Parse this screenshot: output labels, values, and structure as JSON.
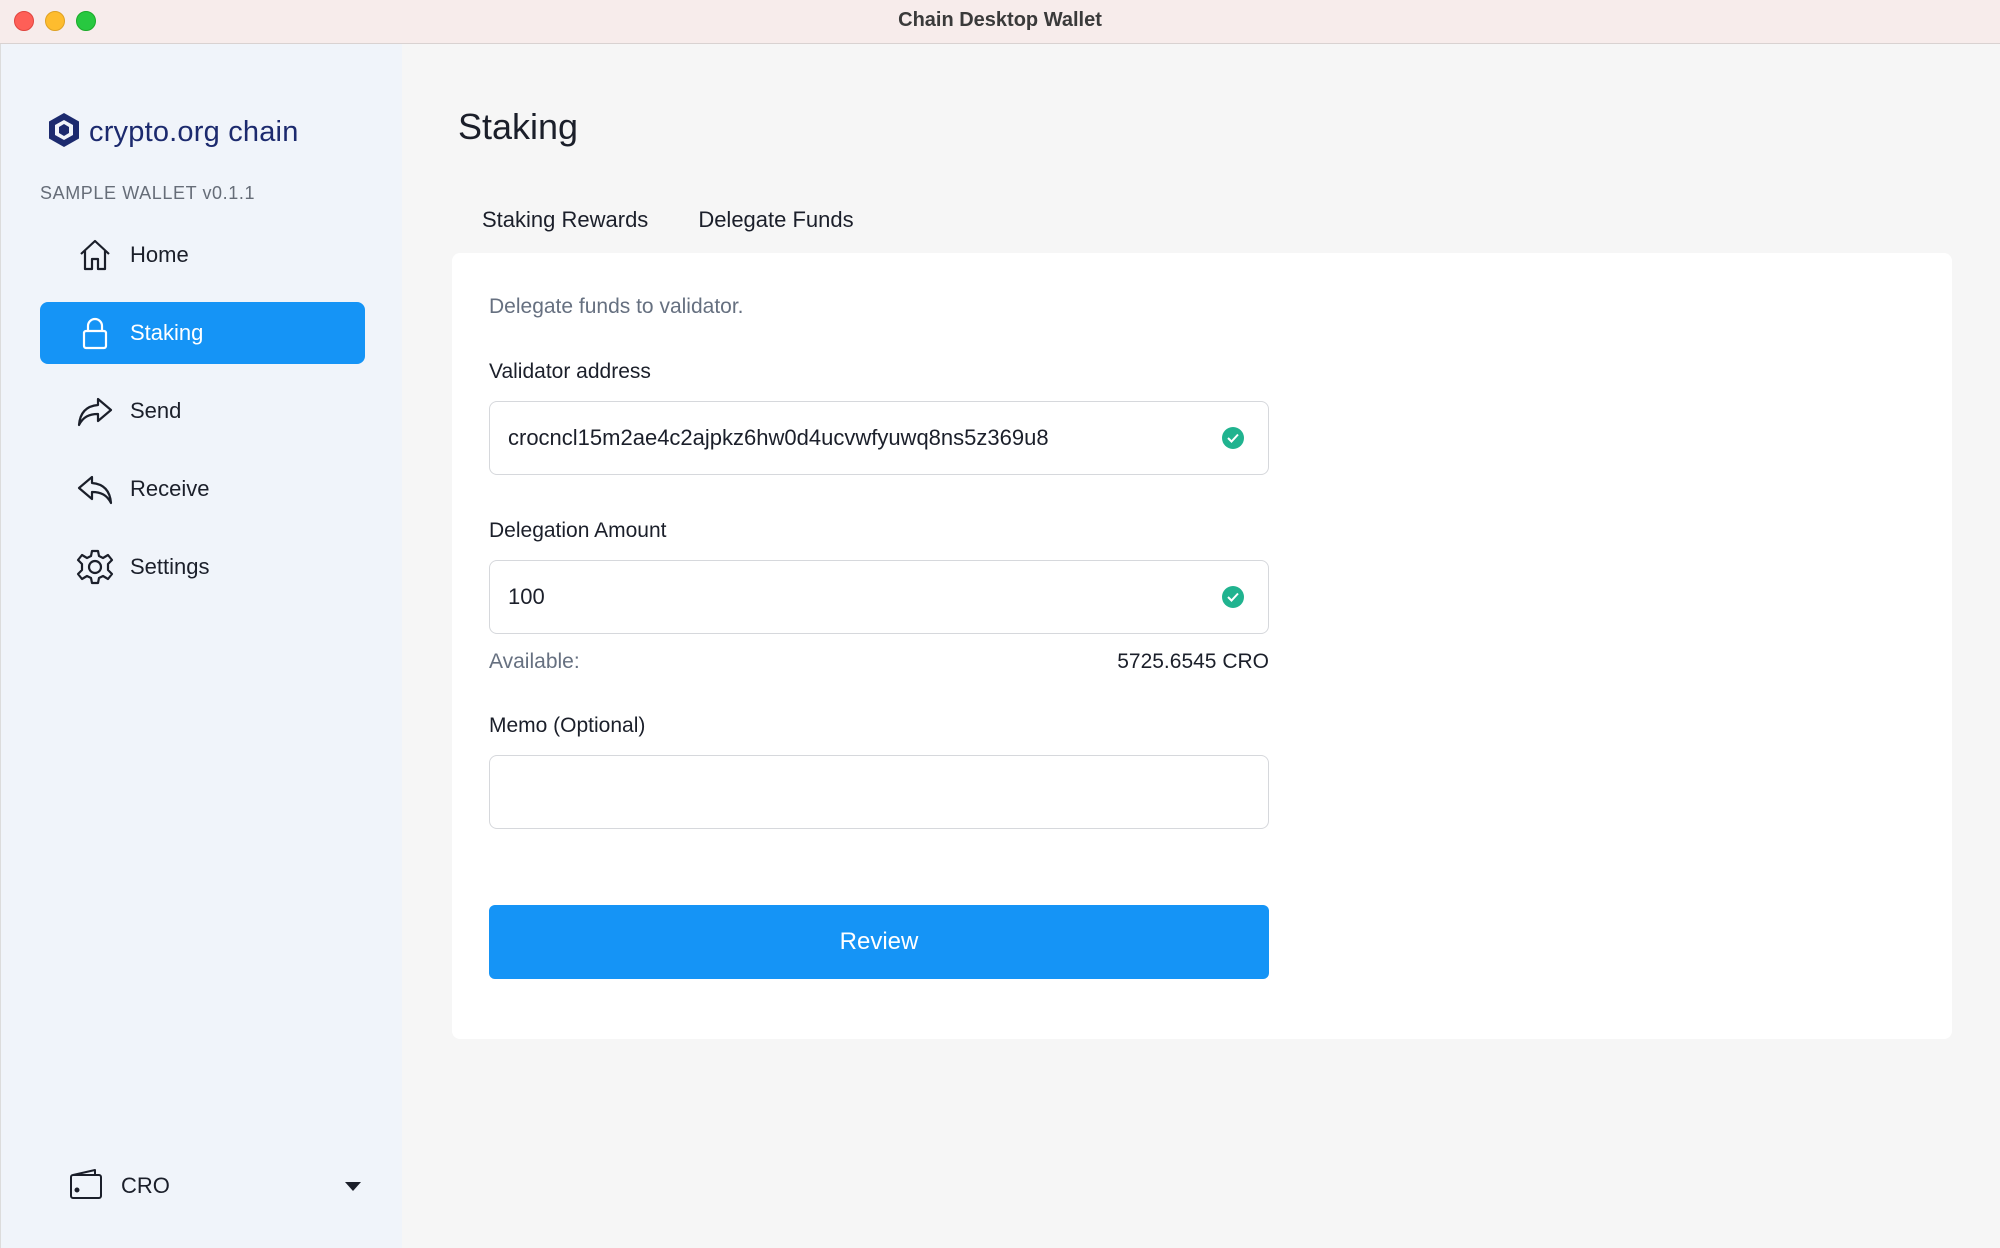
{
  "window": {
    "title": "Chain Desktop Wallet"
  },
  "sidebar": {
    "logo_text": "crypto.org chain",
    "wallet_version": "SAMPLE WALLET v0.1.1",
    "items": [
      {
        "label": "Home",
        "icon": "home-icon"
      },
      {
        "label": "Staking",
        "icon": "lock-icon",
        "active": true
      },
      {
        "label": "Send",
        "icon": "send-arrow-icon"
      },
      {
        "label": "Receive",
        "icon": "receive-arrow-icon"
      },
      {
        "label": "Settings",
        "icon": "gear-icon"
      }
    ],
    "wallet_selector": {
      "label": "CRO",
      "icon": "wallet-icon"
    }
  },
  "main": {
    "title": "Staking",
    "tabs": [
      {
        "label": "Staking Rewards",
        "active": false
      },
      {
        "label": "Delegate Funds",
        "active": true
      }
    ],
    "form": {
      "description": "Delegate funds to validator.",
      "validator_label": "Validator address",
      "validator_value": "crocncl15m2ae4c2ajpkz6hw0d4ucvwfyuwq8ns5z369u8",
      "amount_label": "Delegation Amount",
      "amount_value": "100",
      "available_label": "Available:",
      "available_value": "5725.6545 CRO",
      "memo_label": "Memo (Optional)",
      "memo_value": "",
      "review_label": "Review"
    }
  },
  "colors": {
    "accent": "#1594f6",
    "valid": "#20b38f",
    "brand": "#1c2a6e"
  }
}
